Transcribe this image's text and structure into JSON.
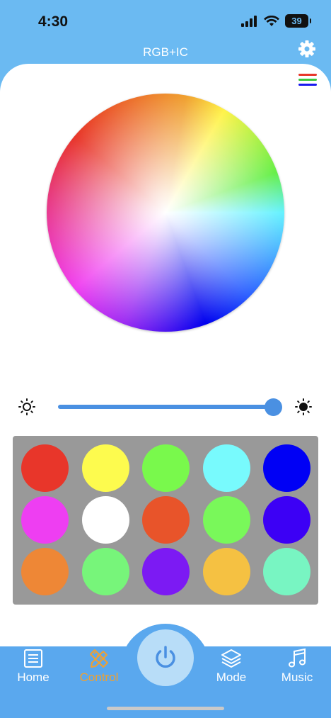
{
  "status": {
    "time": "4:30",
    "battery": "39"
  },
  "header": {
    "title": "RGB+IC"
  },
  "brightness": {
    "value_percent": 100
  },
  "swatches": [
    "#e8362a",
    "#fdfb4e",
    "#79f94c",
    "#78fafd",
    "#0000f5",
    "#ee3ef2",
    "#ffffff",
    "#e8542a",
    "#79f85a",
    "#3c00f5",
    "#ee8736",
    "#77f57a",
    "#7c1af3",
    "#f5c142",
    "#78f5c2"
  ],
  "tabs": [
    {
      "label": "Home"
    },
    {
      "label": "Control"
    },
    {
      "label": "Mode"
    },
    {
      "label": "Music"
    }
  ],
  "colors": {
    "accent": "#4a90e2",
    "active_tab": "#f0a030",
    "header_bg": "#6bbaf2"
  }
}
